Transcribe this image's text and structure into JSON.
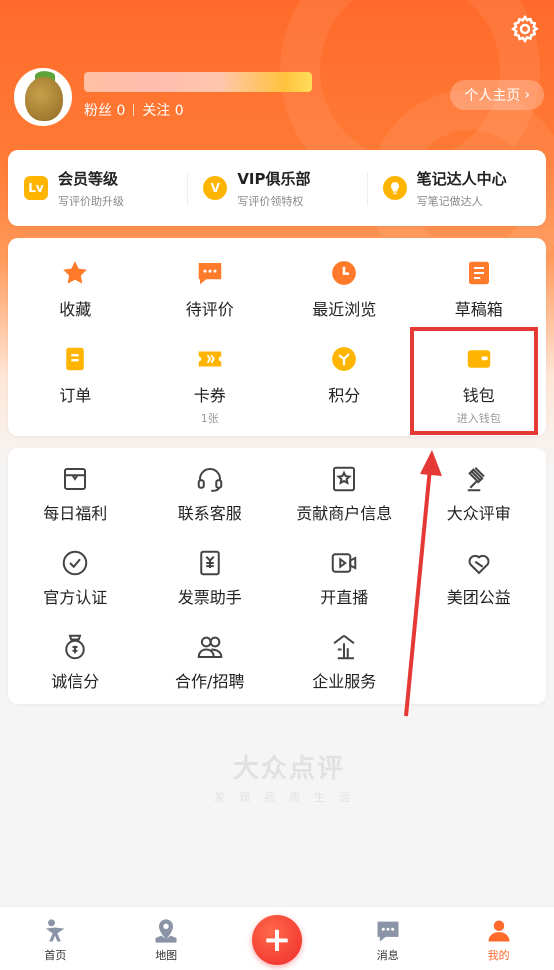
{
  "profile": {
    "fans_label": "粉丝 0",
    "follow_label": "关注 0",
    "homepage_button": "个人主页"
  },
  "member": [
    {
      "icon": "level-badge-icon",
      "icon_text": "Lv",
      "title": "会员等级",
      "subtitle": "写评价助升级"
    },
    {
      "icon": "vip-badge-icon",
      "icon_text": "V",
      "title": "VIP俱乐部",
      "subtitle": "写评价领特权"
    },
    {
      "icon": "bulb-badge-icon",
      "icon_text": "",
      "title": "笔记达人中心",
      "subtitle": "写笔记做达人"
    }
  ],
  "quick_row1": [
    {
      "icon": "star-icon",
      "label": "收藏"
    },
    {
      "icon": "comment-icon",
      "label": "待评价"
    },
    {
      "icon": "clock-icon",
      "label": "最近浏览"
    },
    {
      "icon": "draft-icon",
      "label": "草稿箱"
    }
  ],
  "quick_row2": [
    {
      "icon": "order-icon",
      "label": "订单",
      "sub": ""
    },
    {
      "icon": "coupon-icon",
      "label": "卡券",
      "sub": "1张"
    },
    {
      "icon": "points-icon",
      "label": "积分",
      "sub": ""
    },
    {
      "icon": "wallet-icon",
      "label": "钱包",
      "sub": "进入钱包"
    }
  ],
  "services_row1": [
    {
      "icon": "gift-box-icon",
      "label": "每日福利"
    },
    {
      "icon": "headset-icon",
      "label": "联系客服"
    },
    {
      "icon": "shop-info-icon",
      "label": "贡献商户信息"
    },
    {
      "icon": "gavel-icon",
      "label": "大众评审"
    }
  ],
  "services_row2": [
    {
      "icon": "verified-icon",
      "label": "官方认证"
    },
    {
      "icon": "invoice-icon",
      "label": "发票助手"
    },
    {
      "icon": "live-icon",
      "label": "开直播"
    },
    {
      "icon": "charity-icon",
      "label": "美团公益"
    }
  ],
  "services_row3": [
    {
      "icon": "credit-icon",
      "label": "诚信分"
    },
    {
      "icon": "partner-icon",
      "label": "合作/招聘"
    },
    {
      "icon": "enterprise-icon",
      "label": "企业服务"
    }
  ],
  "watermark": {
    "title": "大众点评",
    "subtitle": "发现品质生活"
  },
  "tabbar": [
    {
      "icon": "home-icon",
      "label": "首页"
    },
    {
      "icon": "map-icon",
      "label": "地图"
    },
    {
      "icon": "plus-icon",
      "label": "+"
    },
    {
      "icon": "message-icon",
      "label": "消息"
    },
    {
      "icon": "profile-icon",
      "label": "我的"
    }
  ],
  "colors": {
    "accent": "#ff6a2b",
    "highlight": "#e53935",
    "badge": "#ffb400"
  }
}
